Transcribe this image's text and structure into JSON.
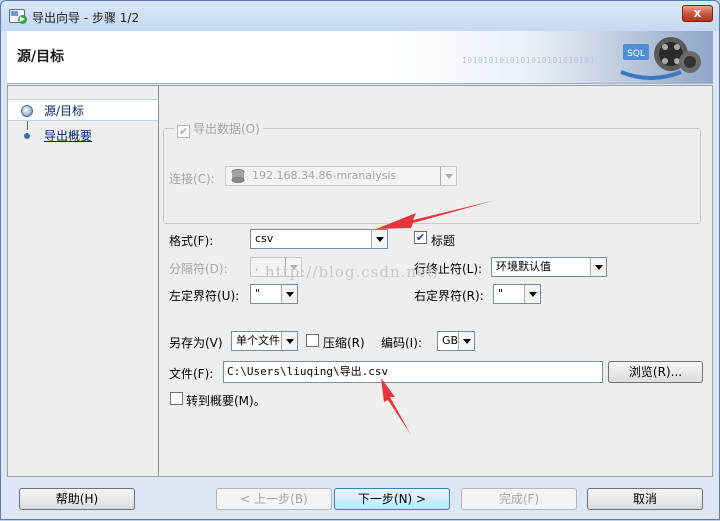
{
  "window": {
    "title": "导出向导 - 步骤 1/2",
    "close_label": "x"
  },
  "header": {
    "title": "源/目标",
    "decor_binary": "1010101010101010101010101",
    "logo_text": "SQL"
  },
  "nav": {
    "items": [
      {
        "label": "源/目标",
        "selected": true
      },
      {
        "label": "导出概要",
        "selected": false
      }
    ]
  },
  "form": {
    "connection": {
      "label": "连接(C):",
      "value": "192.168.34.86-mranalysis"
    },
    "export_data": {
      "label": "导出数据(O)",
      "checked": true
    },
    "format": {
      "label": "格式(F):",
      "value": "csv"
    },
    "header_row": {
      "label": "标题",
      "checked": true
    },
    "delimiter": {
      "label": "分隔符(D):",
      "value": ","
    },
    "line_terminator": {
      "label": "行终止符(L):",
      "value": "环境默认值"
    },
    "left_enclosure": {
      "label": "左定界符(U):",
      "value": "\""
    },
    "right_enclosure": {
      "label": "右定界符(R):",
      "value": "\""
    },
    "save_as": {
      "label": "另存为(V)",
      "value": "单个文件"
    },
    "compress": {
      "label": "压缩(R)",
      "checked": false
    },
    "encoding": {
      "label": "编码(I):",
      "value": "GBK"
    },
    "file": {
      "label": "文件(F):",
      "value": "C:\\Users\\liuqing\\导出.csv"
    },
    "browse_label": "浏览(R)...",
    "goto_summary": {
      "label": "转到概要(M)。",
      "checked": false
    }
  },
  "watermark": "http://blog.csdn.net/",
  "footer": {
    "help": "帮助(H)",
    "back": "< 上一步(B)",
    "next": "下一步(N) >",
    "finish": "完成(F)",
    "cancel": "取消"
  },
  "colors": {
    "accent": "#3c7fb1",
    "annotation_arrow": "#e8353a",
    "close_button": "#c9503b",
    "checkbox_check": "#1f3f8f"
  }
}
